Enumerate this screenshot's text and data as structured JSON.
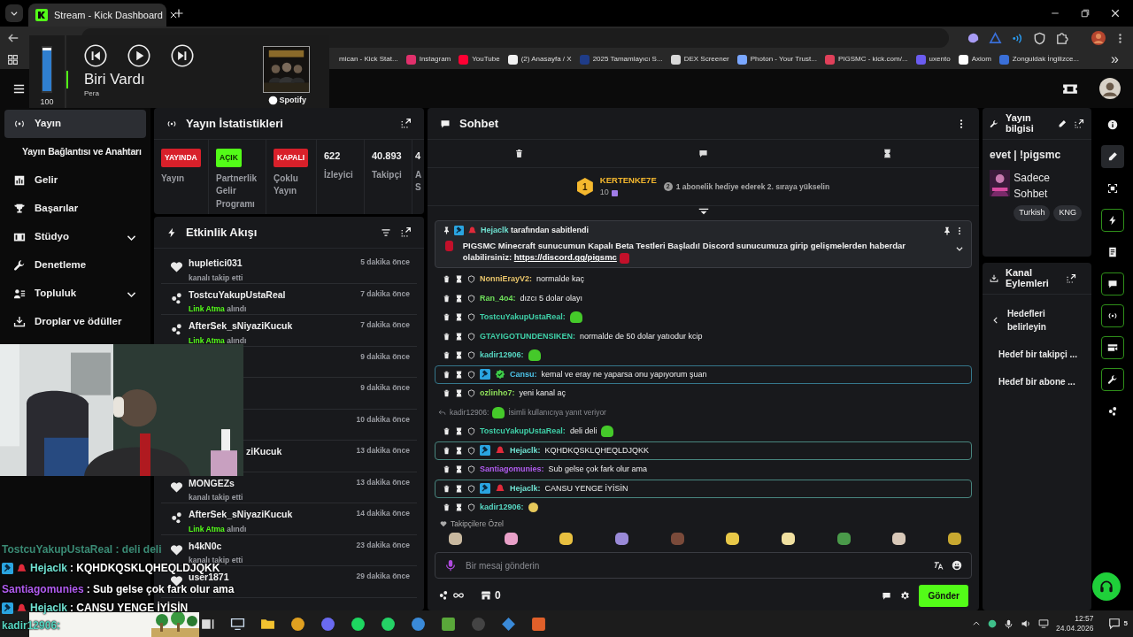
{
  "browser": {
    "tabs": [
      {
        "title": "Stream - Kick Dashboard",
        "selected": true
      }
    ],
    "bookmarks": [
      {
        "label": "mican - Kick Stat..."
      },
      {
        "label": "Instagram",
        "color": "#e1306c"
      },
      {
        "label": "YouTube",
        "color": "#ff0033"
      },
      {
        "label": "(2) Anasayfa / X",
        "color": "#f2f2f2"
      },
      {
        "label": "2025 Tamamlayıcı S...",
        "color": "#1f3c88"
      },
      {
        "label": "DEX Screener",
        "color": "#d9d9d9"
      },
      {
        "label": "Photon - Your Trust...",
        "color": "#7aa7ff"
      },
      {
        "label": "PIGSMC - kick.com/...",
        "color": "#e0405a"
      },
      {
        "label": "uxento",
        "color": "#6b5cf0"
      },
      {
        "label": "Axiom",
        "color": "#ffffff"
      },
      {
        "label": "Zonguldak İngilizce...",
        "color": "#3a6fd8"
      }
    ],
    "more": "»"
  },
  "media_player": {
    "volume": {
      "level": 1,
      "reading": "100"
    },
    "track": "Biri Vardı",
    "artist": "Pera",
    "source": "Spotify"
  },
  "sidebar": {
    "items": [
      {
        "label": "Yayın",
        "kind": "broadcast",
        "selected": true
      },
      {
        "label": "Yayın Bağlantısı ve Anahtarı",
        "kind": "sub",
        "selected": false
      },
      {
        "label": "Gelir",
        "kind": "chart",
        "selected": false
      },
      {
        "label": "Başarılar",
        "kind": "trophy",
        "selected": false
      },
      {
        "label": "Stüdyo",
        "kind": "film",
        "selected": false,
        "expanded": false
      },
      {
        "label": "Denetleme",
        "kind": "wrench",
        "selected": false
      },
      {
        "label": "Topluluk",
        "kind": "people",
        "selected": false,
        "expanded": false
      },
      {
        "label": "Droplar ve ödüller",
        "kind": "drops",
        "selected": false
      }
    ]
  },
  "stats_panel": {
    "title": "Yayın İstatistikleri",
    "stats": [
      {
        "kind": "badge",
        "value": "YAYINDA",
        "color": "#d8202a",
        "label": "Yayın"
      },
      {
        "kind": "badge",
        "value": "AÇIK",
        "color": "#53fc18",
        "label": "Partnerlik Gelir Programı"
      },
      {
        "kind": "badge",
        "value": "KAPALI",
        "color": "#d8202a",
        "label": "Çoklu Yayın"
      },
      {
        "kind": "number",
        "value": "622",
        "label": "İzleyici"
      },
      {
        "kind": "number",
        "value": "40.893",
        "label": "Takipçi"
      },
      {
        "kind": "cut",
        "value": "4",
        "label": "A S"
      }
    ]
  },
  "events_panel": {
    "title": "Etkinlik Akışı",
    "events": [
      {
        "kind": "follow",
        "name": "hupletici031",
        "detail": "kanalı takip etti",
        "time": "5 dakika önce"
      },
      {
        "kind": "reward",
        "name": "TostcuYakupUstaReal",
        "reward": "Link Atma",
        "detail": "alındı",
        "time": "7 dakika önce"
      },
      {
        "kind": "reward",
        "name": "AfterSek_sNiyaziKucuk",
        "reward": "Link Atma",
        "detail": "alındı",
        "time": "7 dakika önce"
      },
      {
        "kind": "covered",
        "time": "9 dakika önce"
      },
      {
        "kind": "covered",
        "time": "9 dakika önce"
      },
      {
        "kind": "covered",
        "time": "10 dakika önce"
      },
      {
        "kind": "covered",
        "name": "ziKucuk",
        "time": "13 dakika önce"
      },
      {
        "kind": "follow",
        "name": "MONGEZs",
        "detail": "kanalı takip etti",
        "time": "13 dakika önce"
      },
      {
        "kind": "reward",
        "name": "AfterSek_sNiyaziKucuk",
        "reward": "Link Atma",
        "detail": "alındı",
        "time": "14 dakika önce"
      },
      {
        "kind": "follow",
        "name": "h4kN0c",
        "detail": "kanalı takip etti",
        "time": "23 dakika önce"
      },
      {
        "kind": "follow",
        "name": "user1871",
        "time": "29 dakika önce"
      }
    ]
  },
  "chat": {
    "title": "Sohbet",
    "leaderboard": {
      "rank": "1",
      "name": "KERTENKE7E",
      "amount": "10",
      "next_rank": "2",
      "hint": "1 abonelik hediye ederek 2. sıraya yükselin"
    },
    "pinned": {
      "by": "Hejaclk",
      "badges": [
        {
          "kind": "mod"
        },
        {
          "kind": "vip"
        }
      ],
      "by_suffix": "tarafından sabitlendi",
      "message": "PIGSMC Minecraft sunucumun Kapalı Beta Testleri Başladı! Discord sunucumuza girip gelişmelerden haberdar olabilirsiniz:",
      "link": "https://discord.gg/pigsmc"
    },
    "messages": [
      {
        "kind": "message",
        "user": "NonniErayV2:",
        "color": "#e8c46a",
        "text": "normalde kaç",
        "emote": false,
        "highlighted": false
      },
      {
        "kind": "message",
        "user": "Ran_4o4:",
        "color": "#6fe05a",
        "text": "dızcı 5 dolar olayı",
        "emote": false,
        "highlighted": false
      },
      {
        "kind": "message",
        "user": "TostcuYakupUstaReal:",
        "color": "#3fd0a8",
        "emote": true,
        "highlighted": false
      },
      {
        "kind": "message",
        "user": "GTAYIGOTUNDENSIKEN:",
        "color": "#3fd0a8",
        "text": "normalde de 50 dolar yatıodur kcip",
        "emote": false,
        "highlighted": false
      },
      {
        "kind": "message",
        "user": "kadir12906:",
        "color": "#56d6c2",
        "emote": true,
        "highlighted": false
      },
      {
        "kind": "message",
        "user": "Cansu:",
        "color": "#4dc3e8",
        "text": "kemal ve eray ne yaparsa onu yapıyorum şuan",
        "badges": [
          {
            "kind": "mod"
          },
          {
            "kind": "verified"
          }
        ],
        "emote": false,
        "highlighted": true
      },
      {
        "kind": "message",
        "user": "ozlinho7:",
        "color": "#8fe05a",
        "text": "yeni kanal aç",
        "emote": false,
        "highlighted": false
      },
      {
        "kind": "reply",
        "user": "kadir12906:",
        "text": "İsimli kullanıcıya yanıt veriyor",
        "emote": true
      },
      {
        "kind": "message",
        "user": "TostcuYakupUstaReal:",
        "color": "#3fd0a8",
        "text": "deli deli",
        "emote": true,
        "highlighted": false
      },
      {
        "kind": "message",
        "user": "Hejaclk:",
        "color": "#6fe0d0",
        "text": "KQHDKQSKLQHEQLDJQKK",
        "badges": [
          {
            "kind": "mod"
          },
          {
            "kind": "vip"
          }
        ],
        "emote": false,
        "highlighted": true
      },
      {
        "kind": "message",
        "user": "Santiagomunies:",
        "color": "#b15cf0",
        "text": "Sub gelse çok fark olur ama",
        "emote": false,
        "highlighted": false
      },
      {
        "kind": "message",
        "user": "Hejaclk:",
        "color": "#6fe0d0",
        "text": "CANSU YENGE İYİSİN",
        "badges": [
          {
            "kind": "mod"
          },
          {
            "kind": "vip"
          }
        ],
        "emote": false,
        "highlighted": true
      },
      {
        "kind": "message",
        "user": "kadir12906:",
        "color": "#56d6c2",
        "emote": true,
        "highlighted": false
      }
    ],
    "emote_section": "Takipçilere Özel",
    "input": {
      "placeholder": "Bir mesaj gönderin"
    },
    "points": "0",
    "send": "Gönder"
  },
  "stream_info": {
    "title": "Yayın bilgisi",
    "stream_title": "evet | !pigsmc",
    "category": "Sadece Sohbet",
    "tags": [
      "Turkish",
      "KNG"
    ]
  },
  "channel_actions": {
    "title": "Kanal Eylemleri",
    "back_label": "Hedefleri belirleyin",
    "items": [
      "Hedef bir takipçi ...",
      "Hedef bir abone ..."
    ]
  },
  "rail": [
    {
      "kind": "info",
      "selected": false,
      "on": false
    },
    {
      "kind": "pencil",
      "selected": true,
      "on": false
    },
    {
      "kind": "screen",
      "selected": false,
      "on": false
    },
    {
      "kind": "bolt",
      "selected": false,
      "on": true
    },
    {
      "kind": "doc",
      "selected": false,
      "on": false
    },
    {
      "kind": "chat",
      "selected": false,
      "on": true
    },
    {
      "kind": "broadcast",
      "selected": false,
      "on": true
    },
    {
      "kind": "video",
      "selected": false,
      "on": true
    },
    {
      "kind": "wrench",
      "selected": false,
      "on": true
    },
    {
      "kind": "cluster",
      "selected": false,
      "on": false
    }
  ],
  "stream_overlay": [
    {
      "user": "TostcuYakupUstaReal",
      "text": ": deli deli",
      "color": "#3a8a74",
      "faded": true
    },
    {
      "user": "Hejaclk",
      "text": ": KQHDKQSKLQHEQLDJQKK",
      "color": "#6fe0d0",
      "badges": [
        {
          "kind": "mod"
        },
        {
          "kind": "vip"
        }
      ],
      "faded": false
    },
    {
      "user": "Santiagomunies",
      "text": ": Sub gelse çok fark olur ama",
      "color": "#b15cf0",
      "faded": false
    },
    {
      "user": "Hejaclk",
      "text": ": CANSU YENGE İYİSİN",
      "color": "#6fe0d0",
      "badges": [
        {
          "kind": "mod"
        },
        {
          "kind": "vip"
        }
      ],
      "faded": false
    },
    {
      "user": "kadir12906:",
      "color": "#56d6c2",
      "faded": false
    }
  ],
  "taskbar": {
    "time": "12:57",
    "date": "24.04.2026",
    "notifications": "5"
  }
}
